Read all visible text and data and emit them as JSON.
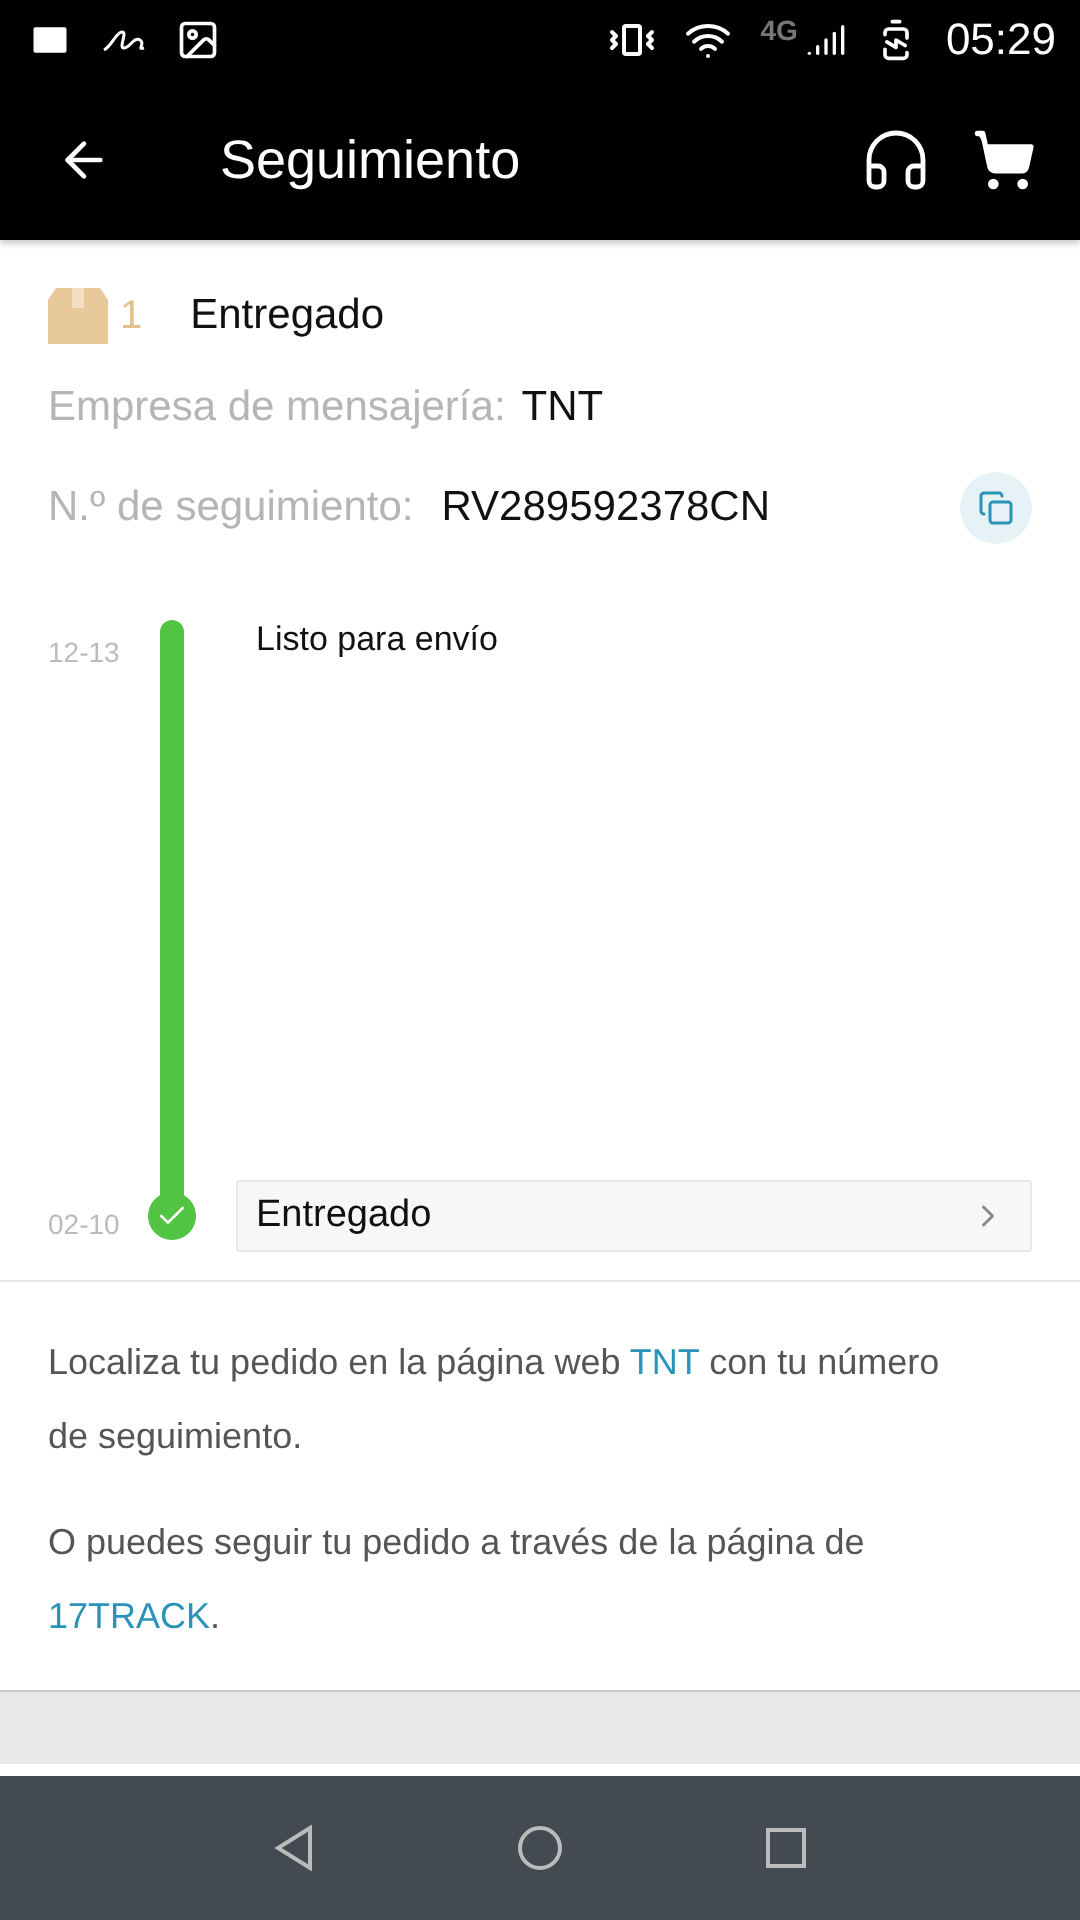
{
  "status_bar": {
    "network": "4G",
    "time": "05:29"
  },
  "app_bar": {
    "title": "Seguimiento"
  },
  "package": {
    "count": "1",
    "status": "Entregado",
    "carrier_label": "Empresa de mensajería:",
    "carrier": "TNT",
    "tracking_label": "N.º de seguimiento:",
    "tracking_number": "RV289592378CN"
  },
  "timeline": [
    {
      "kind": "step",
      "date": "12-13",
      "text": "Listo para envío"
    },
    {
      "kind": "current",
      "date": "02-10",
      "text": "Entregado"
    }
  ],
  "info": [
    [
      {
        "kind": "text",
        "text": "Localiza tu pedido en la página web "
      },
      {
        "kind": "link",
        "text": "TNT"
      },
      {
        "kind": "text",
        "text": " con tu número de seguimiento."
      }
    ],
    [
      {
        "kind": "text",
        "text": "O puedes seguir tu pedido a través de la página de "
      },
      {
        "kind": "link",
        "text": "17TRACK"
      },
      {
        "kind": "text",
        "text": "."
      }
    ]
  ]
}
